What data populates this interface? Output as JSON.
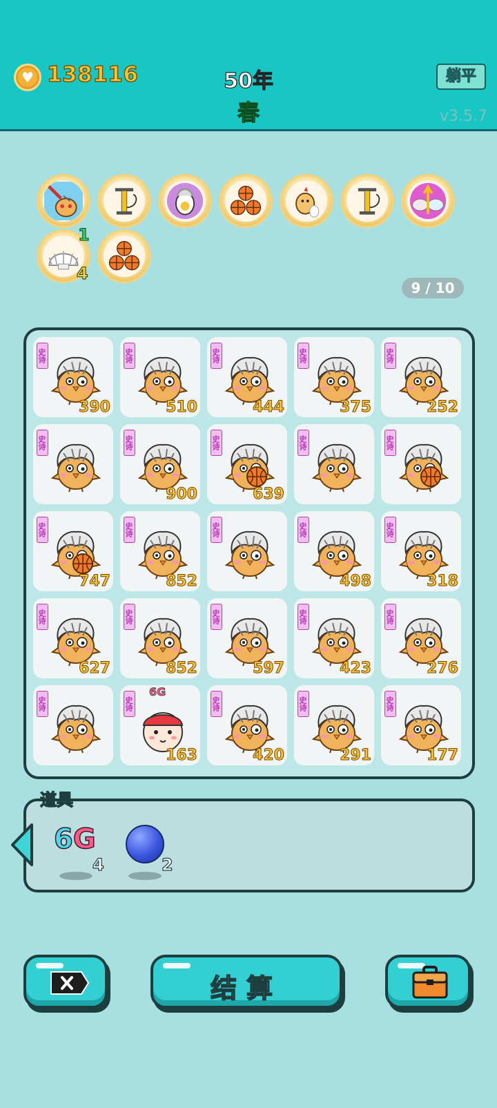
{
  "header": {
    "coins": "138116",
    "year": "50年",
    "season": "春",
    "lie_flat_label": "躺平",
    "version": "v3.5.7"
  },
  "buffs": [
    {
      "icon": "chick-injection-icon"
    },
    {
      "icon": "air-pump-icon"
    },
    {
      "icon": "egg-with-hair-icon"
    },
    {
      "icon": "three-basketballs-icon"
    },
    {
      "icon": "chick-with-egg-icon"
    },
    {
      "icon": "air-pump-icon"
    },
    {
      "icon": "double-bowl-arrow-icon"
    },
    {
      "icon": "scallop-shell-icon",
      "badge_top": "1",
      "badge_bottom": "4"
    },
    {
      "icon": "three-basketballs-icon"
    }
  ],
  "page_indicator": "9 / 10",
  "grid": {
    "cells": [
      {
        "tag": "史诗",
        "value": "390",
        "kind": "chick"
      },
      {
        "tag": "史诗",
        "value": "510",
        "kind": "chick"
      },
      {
        "tag": "史诗",
        "value": "444",
        "kind": "chick"
      },
      {
        "tag": "史诗",
        "value": "375",
        "kind": "chick"
      },
      {
        "tag": "史诗",
        "value": "252",
        "kind": "chick"
      },
      {
        "tag": "史诗",
        "value": "",
        "kind": "chick"
      },
      {
        "tag": "史诗",
        "value": "900",
        "kind": "chick"
      },
      {
        "tag": "史诗",
        "value": "639",
        "kind": "chick-ball"
      },
      {
        "tag": "史诗",
        "value": "",
        "kind": "chick"
      },
      {
        "tag": "史诗",
        "value": "",
        "kind": "chick-ball"
      },
      {
        "tag": "史诗",
        "value": "747",
        "kind": "chick-ball"
      },
      {
        "tag": "史诗",
        "value": "852",
        "kind": "chick"
      },
      {
        "tag": "史诗",
        "value": "",
        "kind": "chick"
      },
      {
        "tag": "史诗",
        "value": "498",
        "kind": "chick"
      },
      {
        "tag": "史诗",
        "value": "318",
        "kind": "chick"
      },
      {
        "tag": "史诗",
        "value": "627",
        "kind": "chick"
      },
      {
        "tag": "史诗",
        "value": "852",
        "kind": "chick"
      },
      {
        "tag": "史诗",
        "value": "597",
        "kind": "chick"
      },
      {
        "tag": "史诗",
        "value": "423",
        "kind": "chick"
      },
      {
        "tag": "史诗",
        "value": "276",
        "kind": "chick"
      },
      {
        "tag": "史诗",
        "value": "",
        "kind": "chick"
      },
      {
        "tag": "史诗",
        "value": "163",
        "kind": "boy-6g",
        "boy_label": "6G"
      },
      {
        "tag": "史诗",
        "value": "420",
        "kind": "chick"
      },
      {
        "tag": "史诗",
        "value": "291",
        "kind": "chick"
      },
      {
        "tag": "史诗",
        "value": "177",
        "kind": "chick"
      }
    ]
  },
  "items": {
    "title": "道具",
    "list": [
      {
        "label_a": "6",
        "label_b": "G",
        "count": "4",
        "icon": "6g-icon"
      },
      {
        "count": "2",
        "icon": "blueberry-icon"
      }
    ]
  },
  "buttons": {
    "settle_label": "结算"
  }
}
